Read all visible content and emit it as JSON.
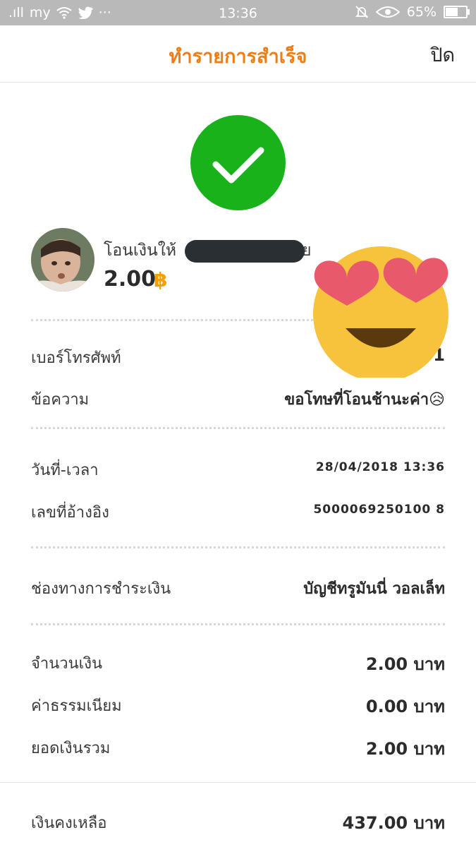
{
  "status_bar": {
    "signal": ".ıll",
    "carrier": "my",
    "more": "···",
    "time": "13:36",
    "battery": "65%",
    "battery_level": 0.65
  },
  "header": {
    "title": "ทำรายการสำเร็จ",
    "close_label": "ปิด"
  },
  "recipient": {
    "label": "โอนเงินให้",
    "name_tail": "ย",
    "amount": "2.00",
    "currency_symbol": "฿"
  },
  "rows": {
    "phone": {
      "label": "เบอร์โทรศัพท์",
      "value": "0           31"
    },
    "message": {
      "label": "ข้อความ",
      "value": "ขอโทษที่โอนช้านะค่า😥"
    },
    "datetime": {
      "label": "วันที่-เวลา",
      "value": "28/04/2018 13:36"
    },
    "reference": {
      "label": "เลขที่อ้างอิง",
      "value": "5000069250100 8"
    },
    "channel": {
      "label": "ช่องทางการชำระเงิน",
      "value": "บัญชีทรูมันนี่ วอลเล็ท"
    },
    "amount": {
      "label": "จำนวนเงิน",
      "value": "2.00 บาท"
    },
    "fee": {
      "label": "ค่าธรรมเนียม",
      "value": "0.00 บาท"
    },
    "total": {
      "label": "ยอดเงินรวม",
      "value": "2.00 บาท"
    },
    "balance": {
      "label": "เงินคงเหลือ",
      "value": "437.00 บาท"
    }
  },
  "colors": {
    "accent": "#ee7d13",
    "success": "#19b21b",
    "baht": "#f5a000"
  },
  "icons": [
    "check-icon",
    "heart-eyes-emoji",
    "wifi-icon",
    "twitter-icon",
    "mute-icon",
    "eye-icon",
    "battery-icon"
  ]
}
